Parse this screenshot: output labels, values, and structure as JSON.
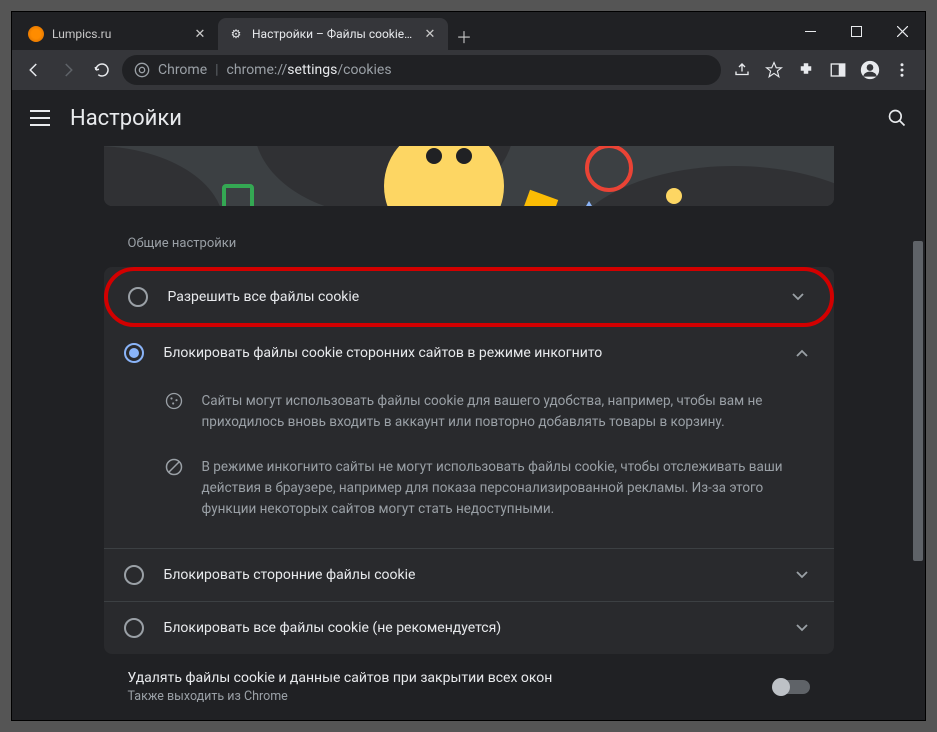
{
  "tabs": [
    {
      "title": "Lumpics.ru",
      "active": false
    },
    {
      "title": "Настройки – Файлы cookie и др",
      "active": true
    }
  ],
  "url": {
    "prefix": "Chrome",
    "path_dim": "chrome://",
    "path_hl": "settings",
    "path_tail": "/cookies"
  },
  "header": {
    "title": "Настройки"
  },
  "section": {
    "label": "Общие настройки"
  },
  "options": [
    {
      "label": "Разрешить все файлы cookie",
      "selected": false,
      "expanded": false,
      "highlighted": true
    },
    {
      "label": "Блокировать файлы cookie сторонних сайтов в режиме инкогнито",
      "selected": true,
      "expanded": true
    },
    {
      "label": "Блокировать сторонние файлы cookie",
      "selected": false,
      "expanded": false
    },
    {
      "label": "Блокировать все файлы cookie (не рекомендуется)",
      "selected": false,
      "expanded": false
    }
  ],
  "details": [
    "Сайты могут использовать файлы cookie для вашего удобства, например, чтобы вам не приходилось вновь входить в аккаунт или повторно добавлять товары в корзину.",
    "В режиме инкогнито сайты не могут использовать файлы cookie, чтобы отслеживать ваши действия в браузере, например для показа персонализированной рекламы. Из-за этого функции некоторых сайтов могут стать недоступными."
  ],
  "toggle": {
    "main": "Удалять файлы cookie и данные сайтов при закрытии всех окон",
    "sub": "Также выходить из Chrome"
  }
}
